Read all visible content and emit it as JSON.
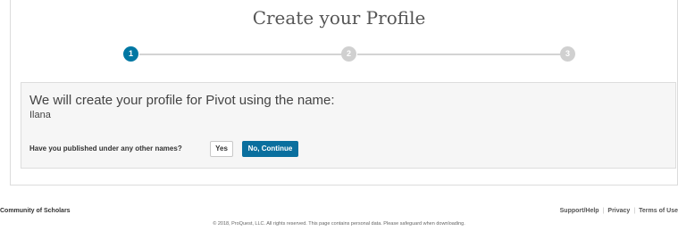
{
  "page": {
    "title": "Create your Profile"
  },
  "stepper": {
    "steps": [
      "1",
      "2",
      "3"
    ],
    "active_step": 1,
    "active_color": "#0077a3",
    "inactive_color": "#d0d0d0"
  },
  "panel": {
    "heading": "We will create your profile for Pivot using the name:",
    "name": "Ilana",
    "question": "Have you published under any other names?",
    "yes_label": "Yes",
    "no_label": "No, Continue",
    "primary_color": "#0a6f9e"
  },
  "footer": {
    "left_link": "Community of Scholars",
    "links": [
      "Support/Help",
      "Privacy",
      "Terms of Use"
    ],
    "copyright": "© 2018, ProQuest, LLC. All rights reserved.   This page contains personal data. Please safeguard when downloading."
  }
}
